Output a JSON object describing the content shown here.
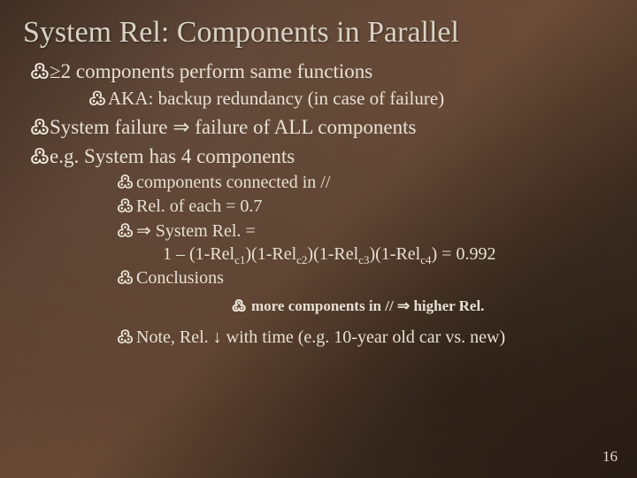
{
  "title": "System Rel: Components in Parallel",
  "lvl1": {
    "i0": "≥2 components perform same functions",
    "i1": "System failure ⇒ failure of ALL components",
    "i2": "e.g. System has 4 components"
  },
  "lvl2": {
    "i0": "AKA: backup redundancy (in case of failure)"
  },
  "lvl3": {
    "i0": "components connected in //",
    "i1": "Rel. of each = 0.7",
    "i2": "⇒ System Rel. =",
    "i2b_pre": "1 – (1-Rel",
    "i2b_c1": "c1",
    "i2b_m1": ")(1-Rel",
    "i2b_c2": "c2",
    "i2b_m2": ")(1-Rel",
    "i2b_c3": "c3",
    "i2b_m3": ")(1-Rel",
    "i2b_c4": "c4",
    "i2b_post": ") = 0.992",
    "i3": "Conclusions",
    "i5": "Note, Rel. ↓ with time (e.g. 10-year old car vs. new)"
  },
  "lvl4": {
    "i0": "more components in // ⇒ higher Rel."
  },
  "page_number": "16",
  "bullet_glyph": "߷"
}
